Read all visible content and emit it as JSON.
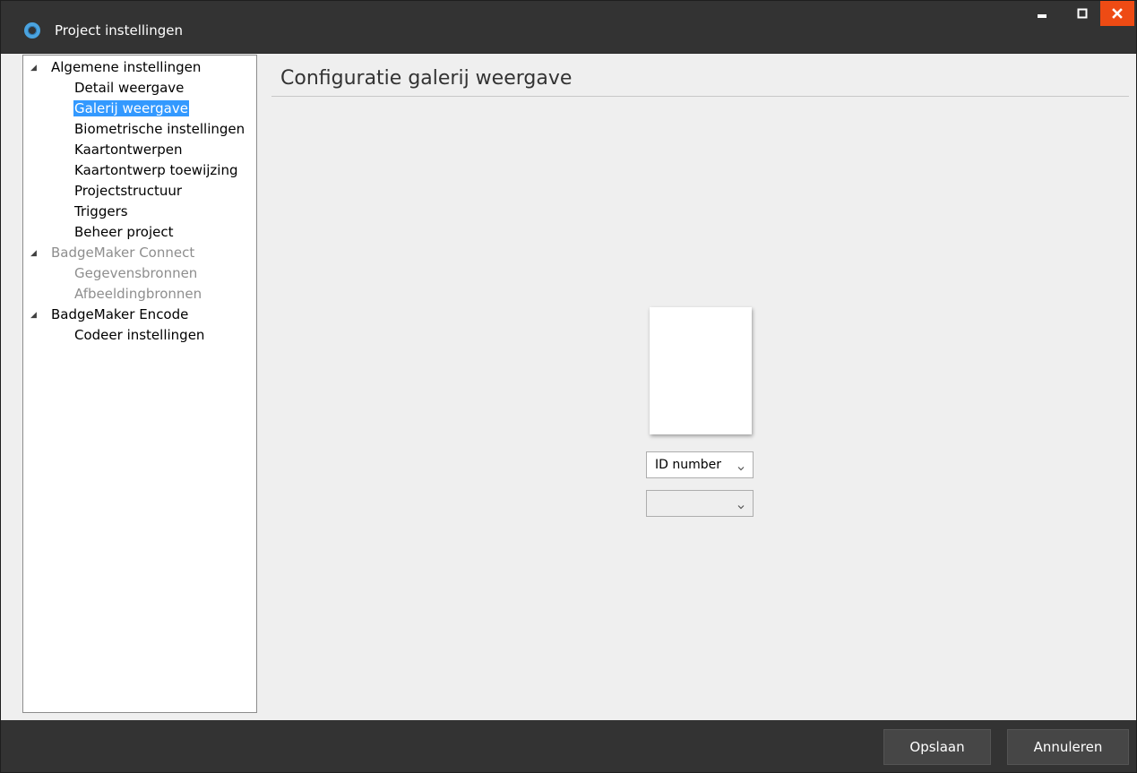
{
  "window": {
    "title": "Project instellingen",
    "app_icon": "ring-logo-icon",
    "controls": {
      "minimize_icon": "minimize-icon",
      "maximize_icon": "maximize-icon",
      "close_icon": "close-icon",
      "close_color": "#ee4b14"
    }
  },
  "tree": {
    "groups": [
      {
        "label": "Algemene instellingen",
        "enabled": true,
        "items": [
          {
            "label": "Detail weergave",
            "selected": false
          },
          {
            "label": "Galerij weergave",
            "selected": true
          },
          {
            "label": "Biometrische instellingen",
            "selected": false
          },
          {
            "label": "Kaartontwerpen",
            "selected": false
          },
          {
            "label": "Kaartontwerp toewijzing",
            "selected": false
          },
          {
            "label": "Projectstructuur",
            "selected": false
          },
          {
            "label": "Triggers",
            "selected": false
          },
          {
            "label": "Beheer project",
            "selected": false
          }
        ]
      },
      {
        "label": "BadgeMaker Connect",
        "enabled": false,
        "items": [
          {
            "label": "Gegevensbronnen",
            "selected": false
          },
          {
            "label": "Afbeeldingbronnen",
            "selected": false
          }
        ]
      },
      {
        "label": "BadgeMaker Encode",
        "enabled": true,
        "items": [
          {
            "label": "Codeer instellingen",
            "selected": false
          }
        ]
      }
    ],
    "selection_color": "#3399ff"
  },
  "main": {
    "heading": "Configuratie galerij weergave",
    "field_1": {
      "value": "ID number"
    },
    "field_2": {
      "value": ""
    }
  },
  "footer": {
    "save_label": "Opslaan",
    "cancel_label": "Annuleren"
  }
}
